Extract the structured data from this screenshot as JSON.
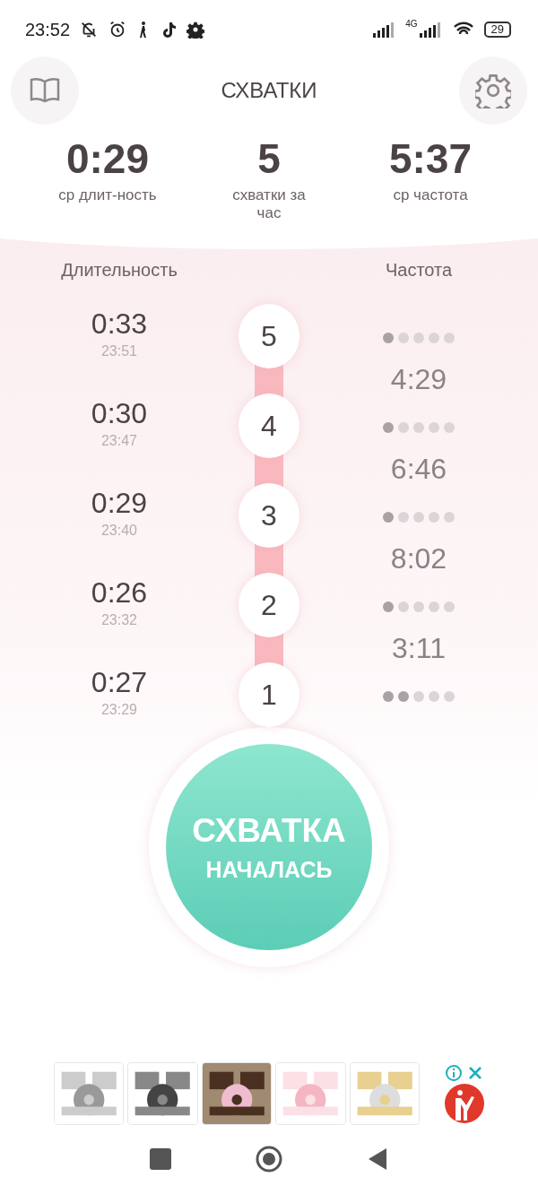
{
  "status_bar": {
    "time": "23:52",
    "network": "4G",
    "battery": "29"
  },
  "header": {
    "title": "СХВАТКИ"
  },
  "stats": [
    {
      "value": "0:29",
      "label": "ср длит-ность"
    },
    {
      "value": "5",
      "label": "схватки за час"
    },
    {
      "value": "5:37",
      "label": "ср частота"
    }
  ],
  "columns": {
    "duration": "Длительность",
    "frequency": "Частота"
  },
  "contractions": [
    {
      "duration": "0:33",
      "time": "23:51",
      "number": "5",
      "stars": 1,
      "interval": "4:29"
    },
    {
      "duration": "0:30",
      "time": "23:47",
      "number": "4",
      "stars": 1,
      "interval": "6:46"
    },
    {
      "duration": "0:29",
      "time": "23:40",
      "number": "3",
      "stars": 1,
      "interval": "8:02"
    },
    {
      "duration": "0:26",
      "time": "23:32",
      "number": "2",
      "stars": 1,
      "interval": "3:11"
    },
    {
      "duration": "0:27",
      "time": "23:29",
      "number": "1",
      "stars": 2
    }
  ],
  "start_button": {
    "line1": "СХВАТКА",
    "line2": "НАЧАЛАСЬ"
  }
}
